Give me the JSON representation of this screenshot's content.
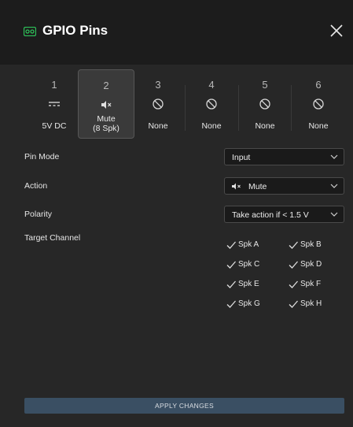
{
  "header": {
    "title": "GPIO Pins"
  },
  "pins": [
    {
      "number": "1",
      "icon": "dc-power-icon",
      "label": "5V DC",
      "sublabel": ""
    },
    {
      "number": "2",
      "icon": "speaker-mute-icon",
      "label": "Mute",
      "sublabel": "(8 Spk)"
    },
    {
      "number": "3",
      "icon": "none-circle-icon",
      "label": "None",
      "sublabel": ""
    },
    {
      "number": "4",
      "icon": "none-circle-icon",
      "label": "None",
      "sublabel": ""
    },
    {
      "number": "5",
      "icon": "none-circle-icon",
      "label": "None",
      "sublabel": ""
    },
    {
      "number": "6",
      "icon": "none-circle-icon",
      "label": "None",
      "sublabel": ""
    }
  ],
  "selected_pin": "2",
  "settings": {
    "pin_mode": {
      "label": "Pin Mode",
      "value": "Input"
    },
    "action": {
      "label": "Action",
      "value": "Mute"
    },
    "polarity": {
      "label": "Polarity",
      "value": "Take action if < 1.5 V"
    },
    "target_channel": {
      "label": "Target Channel"
    }
  },
  "channels": [
    {
      "label": "Spk A",
      "checked": true
    },
    {
      "label": "Spk B",
      "checked": true
    },
    {
      "label": "Spk C",
      "checked": true
    },
    {
      "label": "Spk D",
      "checked": true
    },
    {
      "label": "Spk E",
      "checked": true
    },
    {
      "label": "Spk F",
      "checked": true
    },
    {
      "label": "Spk G",
      "checked": true
    },
    {
      "label": "Spk H",
      "checked": true
    }
  ],
  "apply_label": "APPLY CHANGES",
  "colors": {
    "accent": "#2ec45a",
    "apply_bg": "#3a4f63"
  }
}
